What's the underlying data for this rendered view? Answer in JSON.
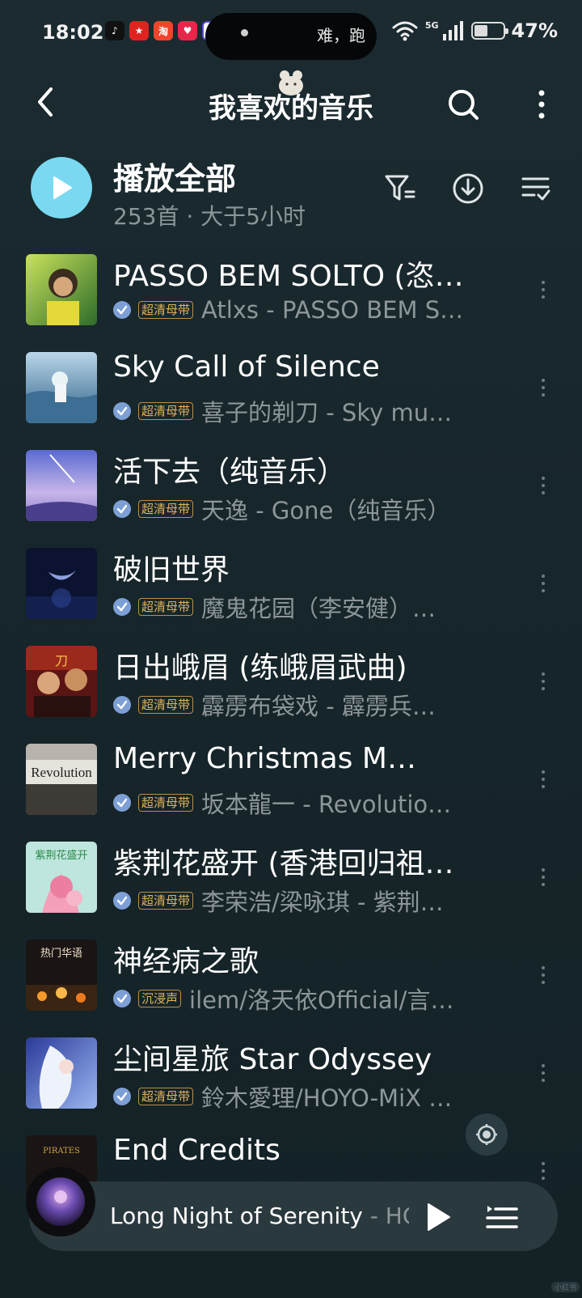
{
  "status_bar": {
    "time": "18:02",
    "island_text": "难，跑",
    "network": "5G",
    "battery_percent": "47%",
    "battery_level": 0.47
  },
  "header": {
    "title": "我喜欢的音乐"
  },
  "play_all": {
    "label": "播放全部",
    "meta": "253首 · 大于5小时"
  },
  "songs": [
    {
      "title": "PASSO BEM SOLTO (恣…",
      "badge": "超清母带",
      "artist": "Atlxs - PASSO BEM S…",
      "cover": "green"
    },
    {
      "title": "Sky Call of Silence",
      "badge": "超清母带",
      "artist": "喜子的剃刀 - Sky mu…",
      "cover": "sea"
    },
    {
      "title": "活下去（纯音乐）",
      "badge": "超清母带",
      "artist": "天逸 - Gone（纯音乐）",
      "cover": "purple"
    },
    {
      "title": "破旧世界",
      "badge": "超清母带",
      "artist": "魔鬼花园（李安健）…",
      "cover": "night"
    },
    {
      "title": "日出峨眉 (练峨眉武曲)",
      "badge": "超清母带",
      "artist": "霹雳布袋戏 - 霹雳兵…",
      "cover": "red"
    },
    {
      "title": "Merry Christmas M…",
      "badge": "超清母带",
      "artist": "坂本龍一 - Revolutio…",
      "cover": "revolution",
      "cover_text": "Revolution"
    },
    {
      "title": "紫荆花盛开 (香港回归祖…",
      "badge": "超清母带",
      "artist": "李荣浩/梁咏琪 - 紫荆…",
      "cover": "flower",
      "cover_text": "紫荆花盛开"
    },
    {
      "title": "神经病之歌",
      "badge": "沉浸声",
      "artist": "ilem/洛天依Official/言…",
      "cover": "fire",
      "cover_text": "热门华语"
    },
    {
      "title": "尘间星旅 Star Odyssey",
      "badge": "超清母带",
      "artist": "鈴木愛理/HOYO-MiX …",
      "cover": "anime"
    },
    {
      "title": "End Credits",
      "badge": "",
      "artist": "",
      "cover": "pirates"
    }
  ],
  "player": {
    "title": "Long Night of Serenity",
    "artist_sep": " - ",
    "artist": "HOYO-MiX"
  },
  "watermark": "小红书",
  "colors": {
    "accent": "#7ad9f0",
    "badge": "#e1b25a",
    "check": "#7d9fd6",
    "background": "#1b2b30"
  },
  "icons": [
    "back-icon",
    "search-icon",
    "more-vertical-icon",
    "play-icon",
    "filter-icon",
    "download-icon",
    "sort-icon",
    "check-icon",
    "locate-icon",
    "queue-icon"
  ]
}
